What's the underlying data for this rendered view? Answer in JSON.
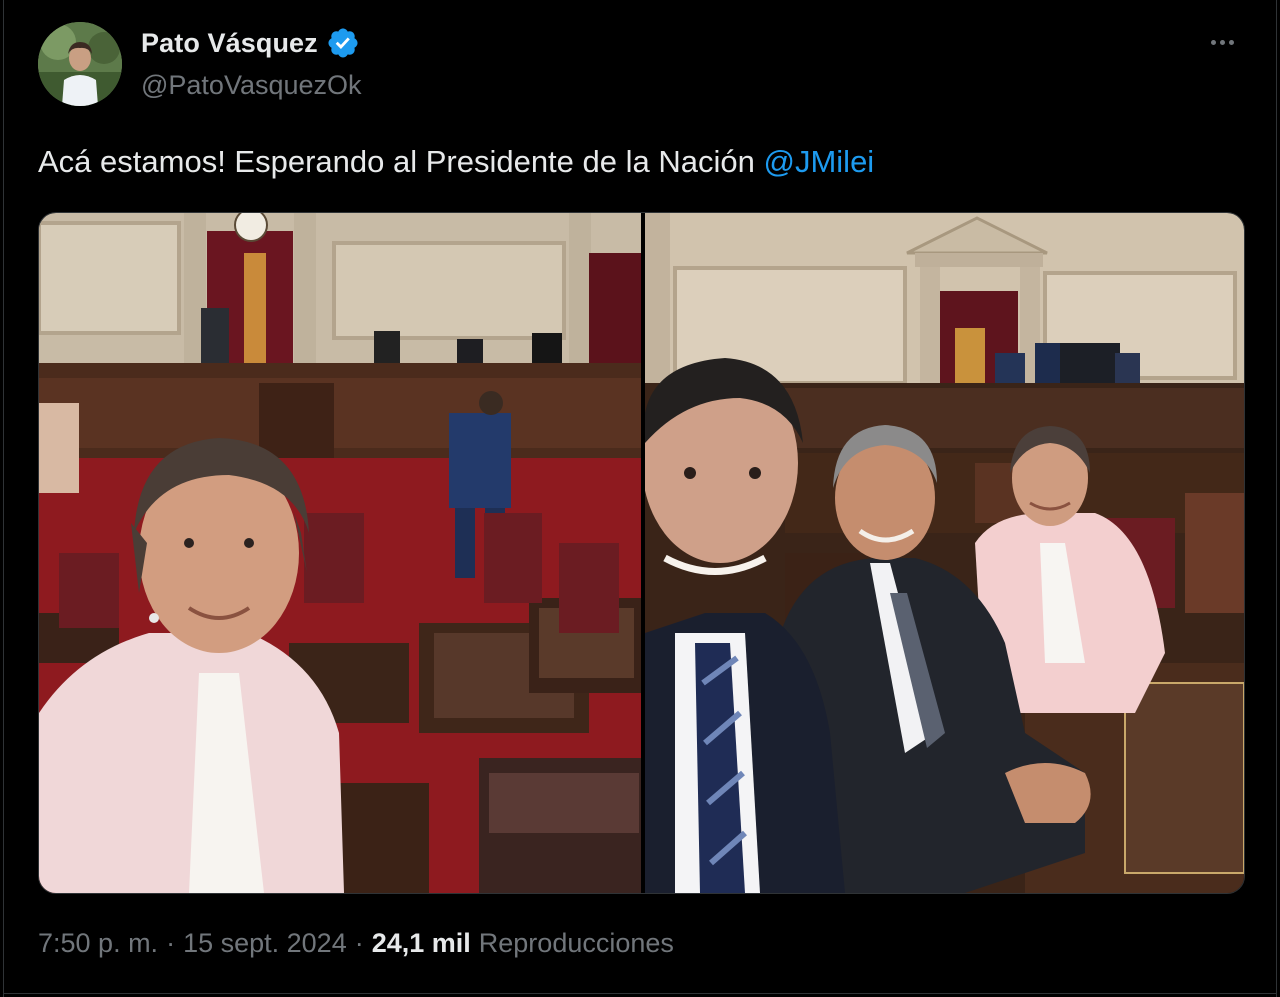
{
  "author": {
    "display_name": "Pato Vásquez",
    "handle": "@PatoVasquezOk",
    "verified": true,
    "avatar_icon": "profile-photo"
  },
  "tweet": {
    "text": "Acá estamos! Esperando al Presidente de la Nación",
    "mention": "@JMilei"
  },
  "media": {
    "count": 2,
    "photos": [
      {
        "name": "photo-selfie-woman-chamber"
      },
      {
        "name": "photo-three-legislators-seated"
      }
    ]
  },
  "meta": {
    "time": "7:50 p. m.",
    "separator": "·",
    "date": "15 sept. 2024",
    "views_count": "24,1 mil",
    "views_label": "Reproducciones"
  },
  "colors": {
    "background": "#000000",
    "text": "#e7e9ea",
    "muted": "#71767b",
    "accent": "#1d9bf0"
  },
  "icons": {
    "verified": "verified-badge-icon",
    "more": "more-dots-icon"
  }
}
